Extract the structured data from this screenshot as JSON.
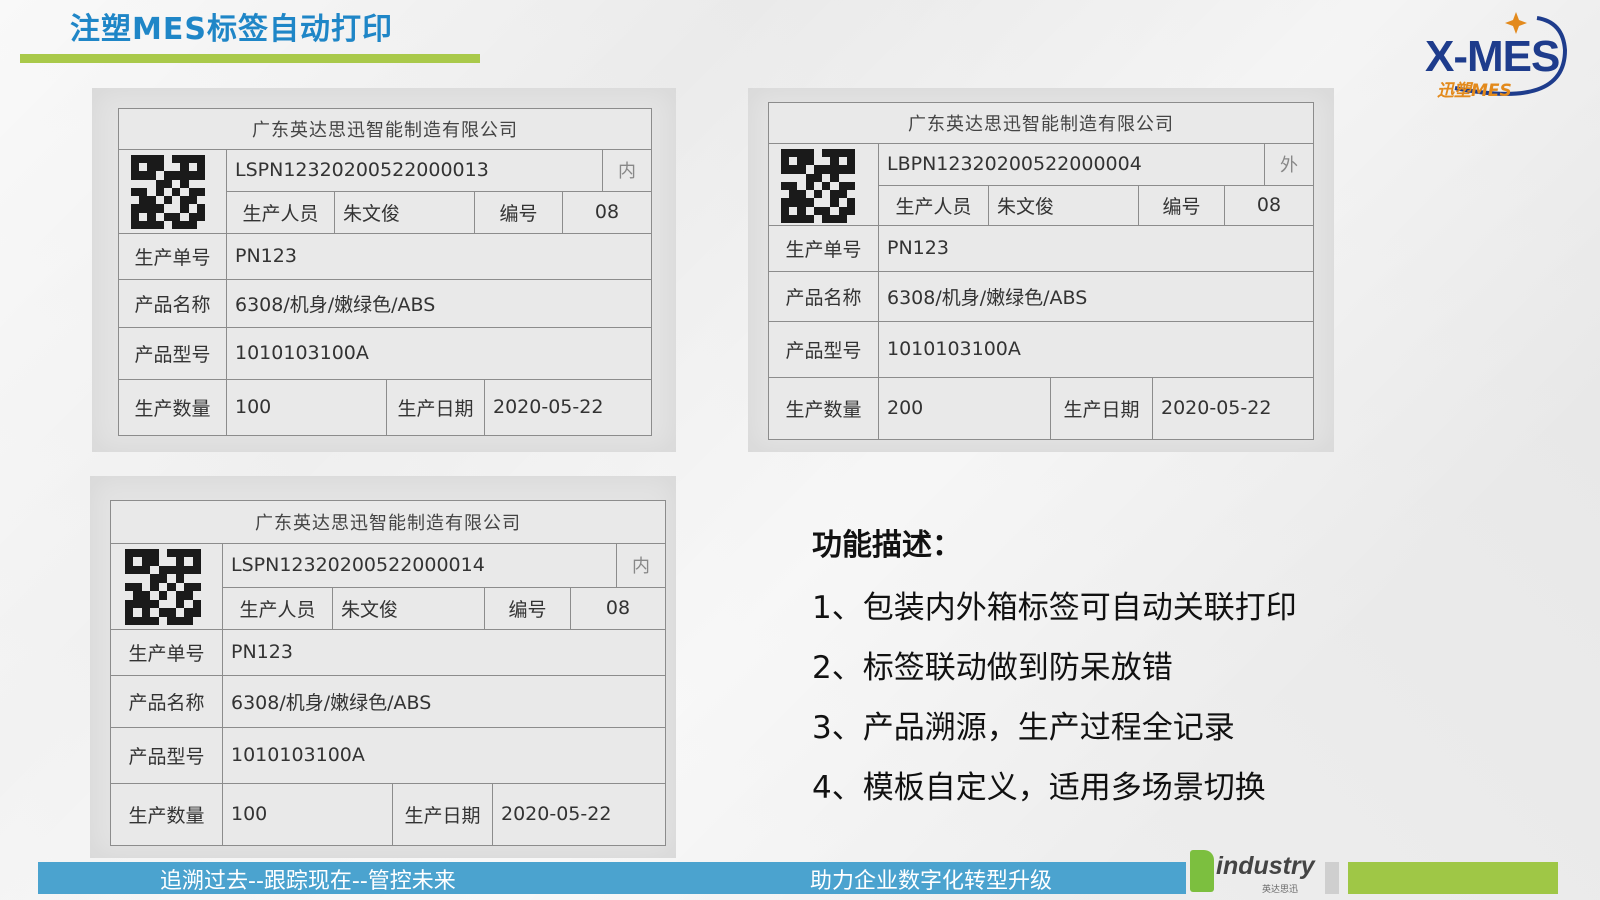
{
  "page": {
    "title": "注塑MES标签自动打印"
  },
  "logo": {
    "main": "X-MES",
    "sub": "迅塑MES"
  },
  "labels": [
    {
      "company": "广东英达思迅智能制造有限公司",
      "code": "LSPN12320200522000013",
      "box_type": "内",
      "worker_label": "生产人员",
      "worker": "朱文俊",
      "number_label": "编号",
      "number": "08",
      "order_label": "生产单号",
      "order": "PN123",
      "product_label": "产品名称",
      "product": "6308/机身/嫩绿色/ABS",
      "model_label": "产品型号",
      "model": "1010103100A",
      "qty_label": "生产数量",
      "qty": "100",
      "date_label": "生产日期",
      "date": "2020-05-22"
    },
    {
      "company": "广东英达思迅智能制造有限公司",
      "code": "LBPN12320200522000004",
      "box_type": "外",
      "worker_label": "生产人员",
      "worker": "朱文俊",
      "number_label": "编号",
      "number": "08",
      "order_label": "生产单号",
      "order": "PN123",
      "product_label": "产品名称",
      "product": "6308/机身/嫩绿色/ABS",
      "model_label": "产品型号",
      "model": "1010103100A",
      "qty_label": "生产数量",
      "qty": "200",
      "date_label": "生产日期",
      "date": "2020-05-22"
    },
    {
      "company": "广东英达思迅智能制造有限公司",
      "code": "LSPN12320200522000014",
      "box_type": "内",
      "worker_label": "生产人员",
      "worker": "朱文俊",
      "number_label": "编号",
      "number": "08",
      "order_label": "生产单号",
      "order": "PN123",
      "product_label": "产品名称",
      "product": "6308/机身/嫩绿色/ABS",
      "model_label": "产品型号",
      "model": "1010103100A",
      "qty_label": "生产数量",
      "qty": "100",
      "date_label": "生产日期",
      "date": "2020-05-22"
    }
  ],
  "description": {
    "title": "功能描述：",
    "items": [
      "1、包装内外箱标签可自动关联打印",
      "2、标签联动做到防呆放错",
      "3、产品溯源，生产过程全记录",
      "4、模板自定义，适用多场景切换"
    ]
  },
  "footer": {
    "left": "追溯过去--跟踪现在--管控未来",
    "right": "助力企业数字化转型升级",
    "brand": "industry",
    "brand_sub": "英达思迅"
  },
  "colors": {
    "title_blue": "#1f86c7",
    "accent_green": "#a9c94a",
    "footer_blue": "#4ba3cf",
    "logo_navy": "#1e3c8c",
    "logo_orange": "#e38a1c"
  }
}
